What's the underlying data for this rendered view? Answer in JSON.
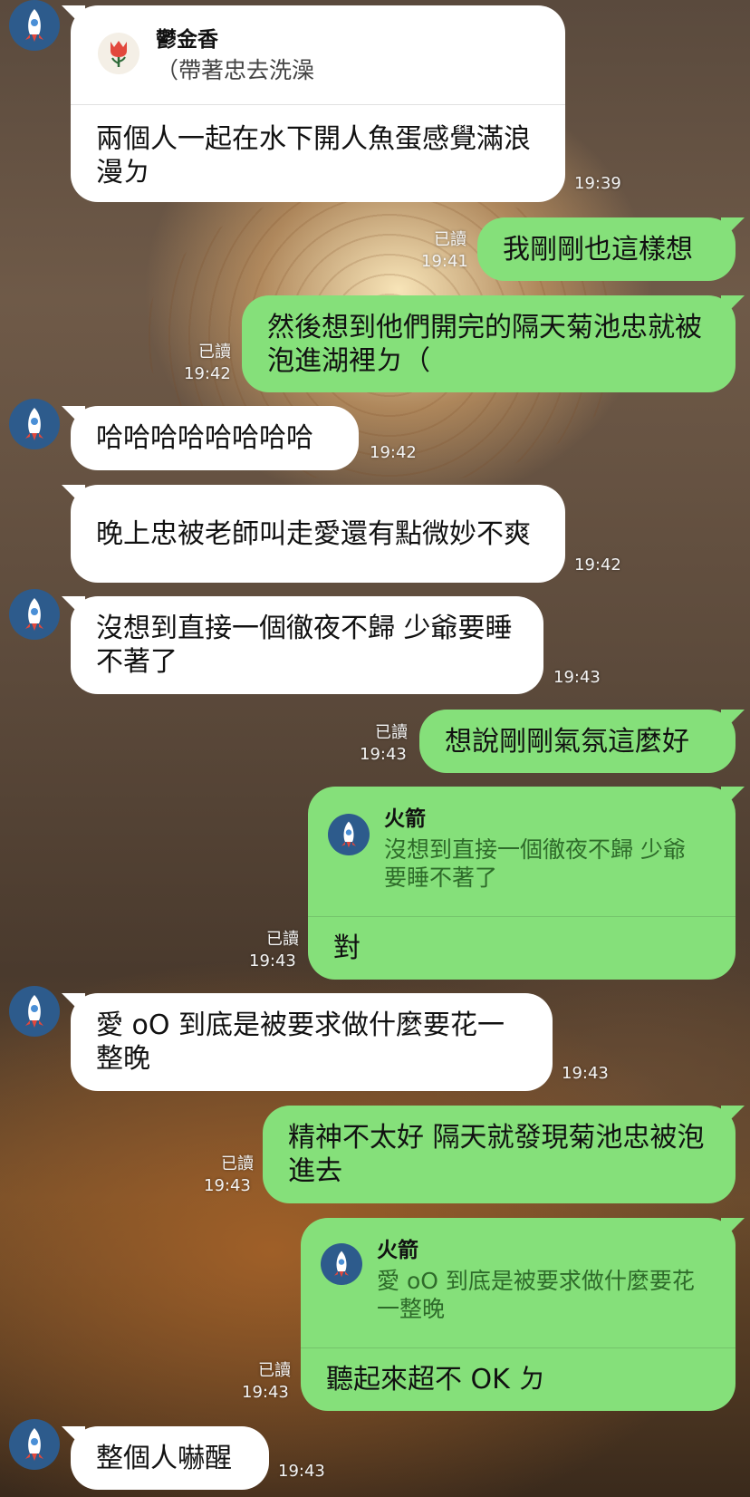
{
  "messages": [
    {
      "text": "兩個人一起在水下開人魚蛋感覺滿浪漫ㄉ",
      "time": "19:39",
      "reply_name": "鬱金香",
      "reply_text": "（帶著忠去洗澡"
    },
    {
      "text": "我剛剛也這樣想",
      "time": "19:41",
      "read": "已讀"
    },
    {
      "text": "然後想到他們開完的隔天菊池忠就被泡進湖裡ㄉ（",
      "time": "19:42",
      "read": "已讀"
    },
    {
      "text": "哈哈哈哈哈哈哈哈",
      "time": "19:42"
    },
    {
      "text": "晚上忠被老師叫走愛還有點微妙不爽",
      "time": "19:42"
    },
    {
      "text": "沒想到直接一個徹夜不歸 少爺要睡不著了",
      "time": "19:43"
    },
    {
      "text": "想說剛剛氣氛這麼好",
      "time": "19:43",
      "read": "已讀"
    },
    {
      "text": "對",
      "time": "19:43",
      "read": "已讀",
      "reply_name": "火箭",
      "reply_text": "沒想到直接一個徹夜不歸 少爺要睡不著了"
    },
    {
      "text": "愛 oO 到底是被要求做什麼要花一整晚",
      "time": "19:43"
    },
    {
      "text": "精神不太好 隔天就發現菊池忠被泡進去",
      "time": "19:43",
      "read": "已讀"
    },
    {
      "text": "聽起來超不 OK ㄉ",
      "time": "19:43",
      "read": "已讀",
      "reply_name": "火箭",
      "reply_text": "愛 oO 到底是被要求做什麼要花一整晚"
    },
    {
      "text": "整個人嚇醒",
      "time": "19:43"
    }
  ],
  "icons": {
    "avatar": "rocket-icon",
    "reply_avatar": "tulip-icon"
  },
  "colors": {
    "incoming_bubble": "#ffffff",
    "outgoing_bubble": "#85e07a",
    "avatar_bg": "#2d5b8c",
    "rocket_red": "#e2483d"
  }
}
